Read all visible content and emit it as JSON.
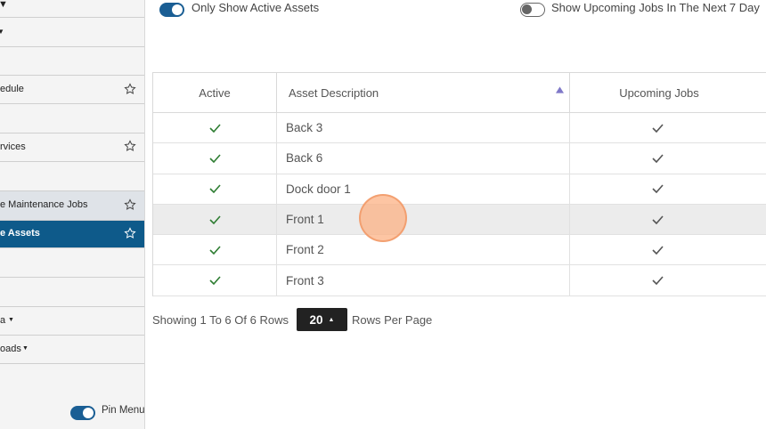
{
  "sidebar": {
    "items": [
      {
        "label": "",
        "caret": "▼"
      },
      {
        "label": "",
        "caret": "▼"
      },
      {
        "label": ""
      },
      {
        "label": "edule",
        "star": true
      },
      {
        "label": ""
      },
      {
        "label": "rvices",
        "star": true
      },
      {
        "label": ""
      },
      {
        "label": "e Maintenance Jobs",
        "star": true,
        "state": "hover"
      },
      {
        "label": "e Assets",
        "star": true,
        "state": "active"
      },
      {
        "label": ""
      },
      {
        "label": ""
      },
      {
        "label": "a",
        "caret": "▼"
      },
      {
        "label": "oads",
        "caret": "▼"
      }
    ],
    "pin_menu_label": "Pin Menu",
    "pin_menu_on": true
  },
  "filters": {
    "active_assets_label": "Only Show Active Assets",
    "active_assets_on": true,
    "upcoming_jobs_label": "Show Upcoming Jobs In The Next 7 Day",
    "upcoming_jobs_on": false
  },
  "table": {
    "headers": {
      "active": "Active",
      "description": "Asset Description",
      "upcoming": "Upcoming Jobs"
    },
    "rows": [
      {
        "active": "✓",
        "description": "Back 3",
        "upcoming": "✓"
      },
      {
        "active": "✓",
        "description": "Back 6",
        "upcoming": "✓"
      },
      {
        "active": "✓",
        "description": "Dock door 1",
        "upcoming": "✓"
      },
      {
        "active": "✓",
        "description": "Front 1",
        "upcoming": "✓"
      },
      {
        "active": "✓",
        "description": "Front 2",
        "upcoming": "✓"
      },
      {
        "active": "✓",
        "description": "Front 3",
        "upcoming": "✓"
      }
    ]
  },
  "pagination": {
    "showing": "Showing 1 To 6 Of 6 Rows",
    "page_size": "20",
    "rows_per_page": "Rows Per Page"
  },
  "colors": {
    "accent": "#0e5a8a",
    "check_green": "#2e7d32",
    "check_gray": "#555555"
  }
}
